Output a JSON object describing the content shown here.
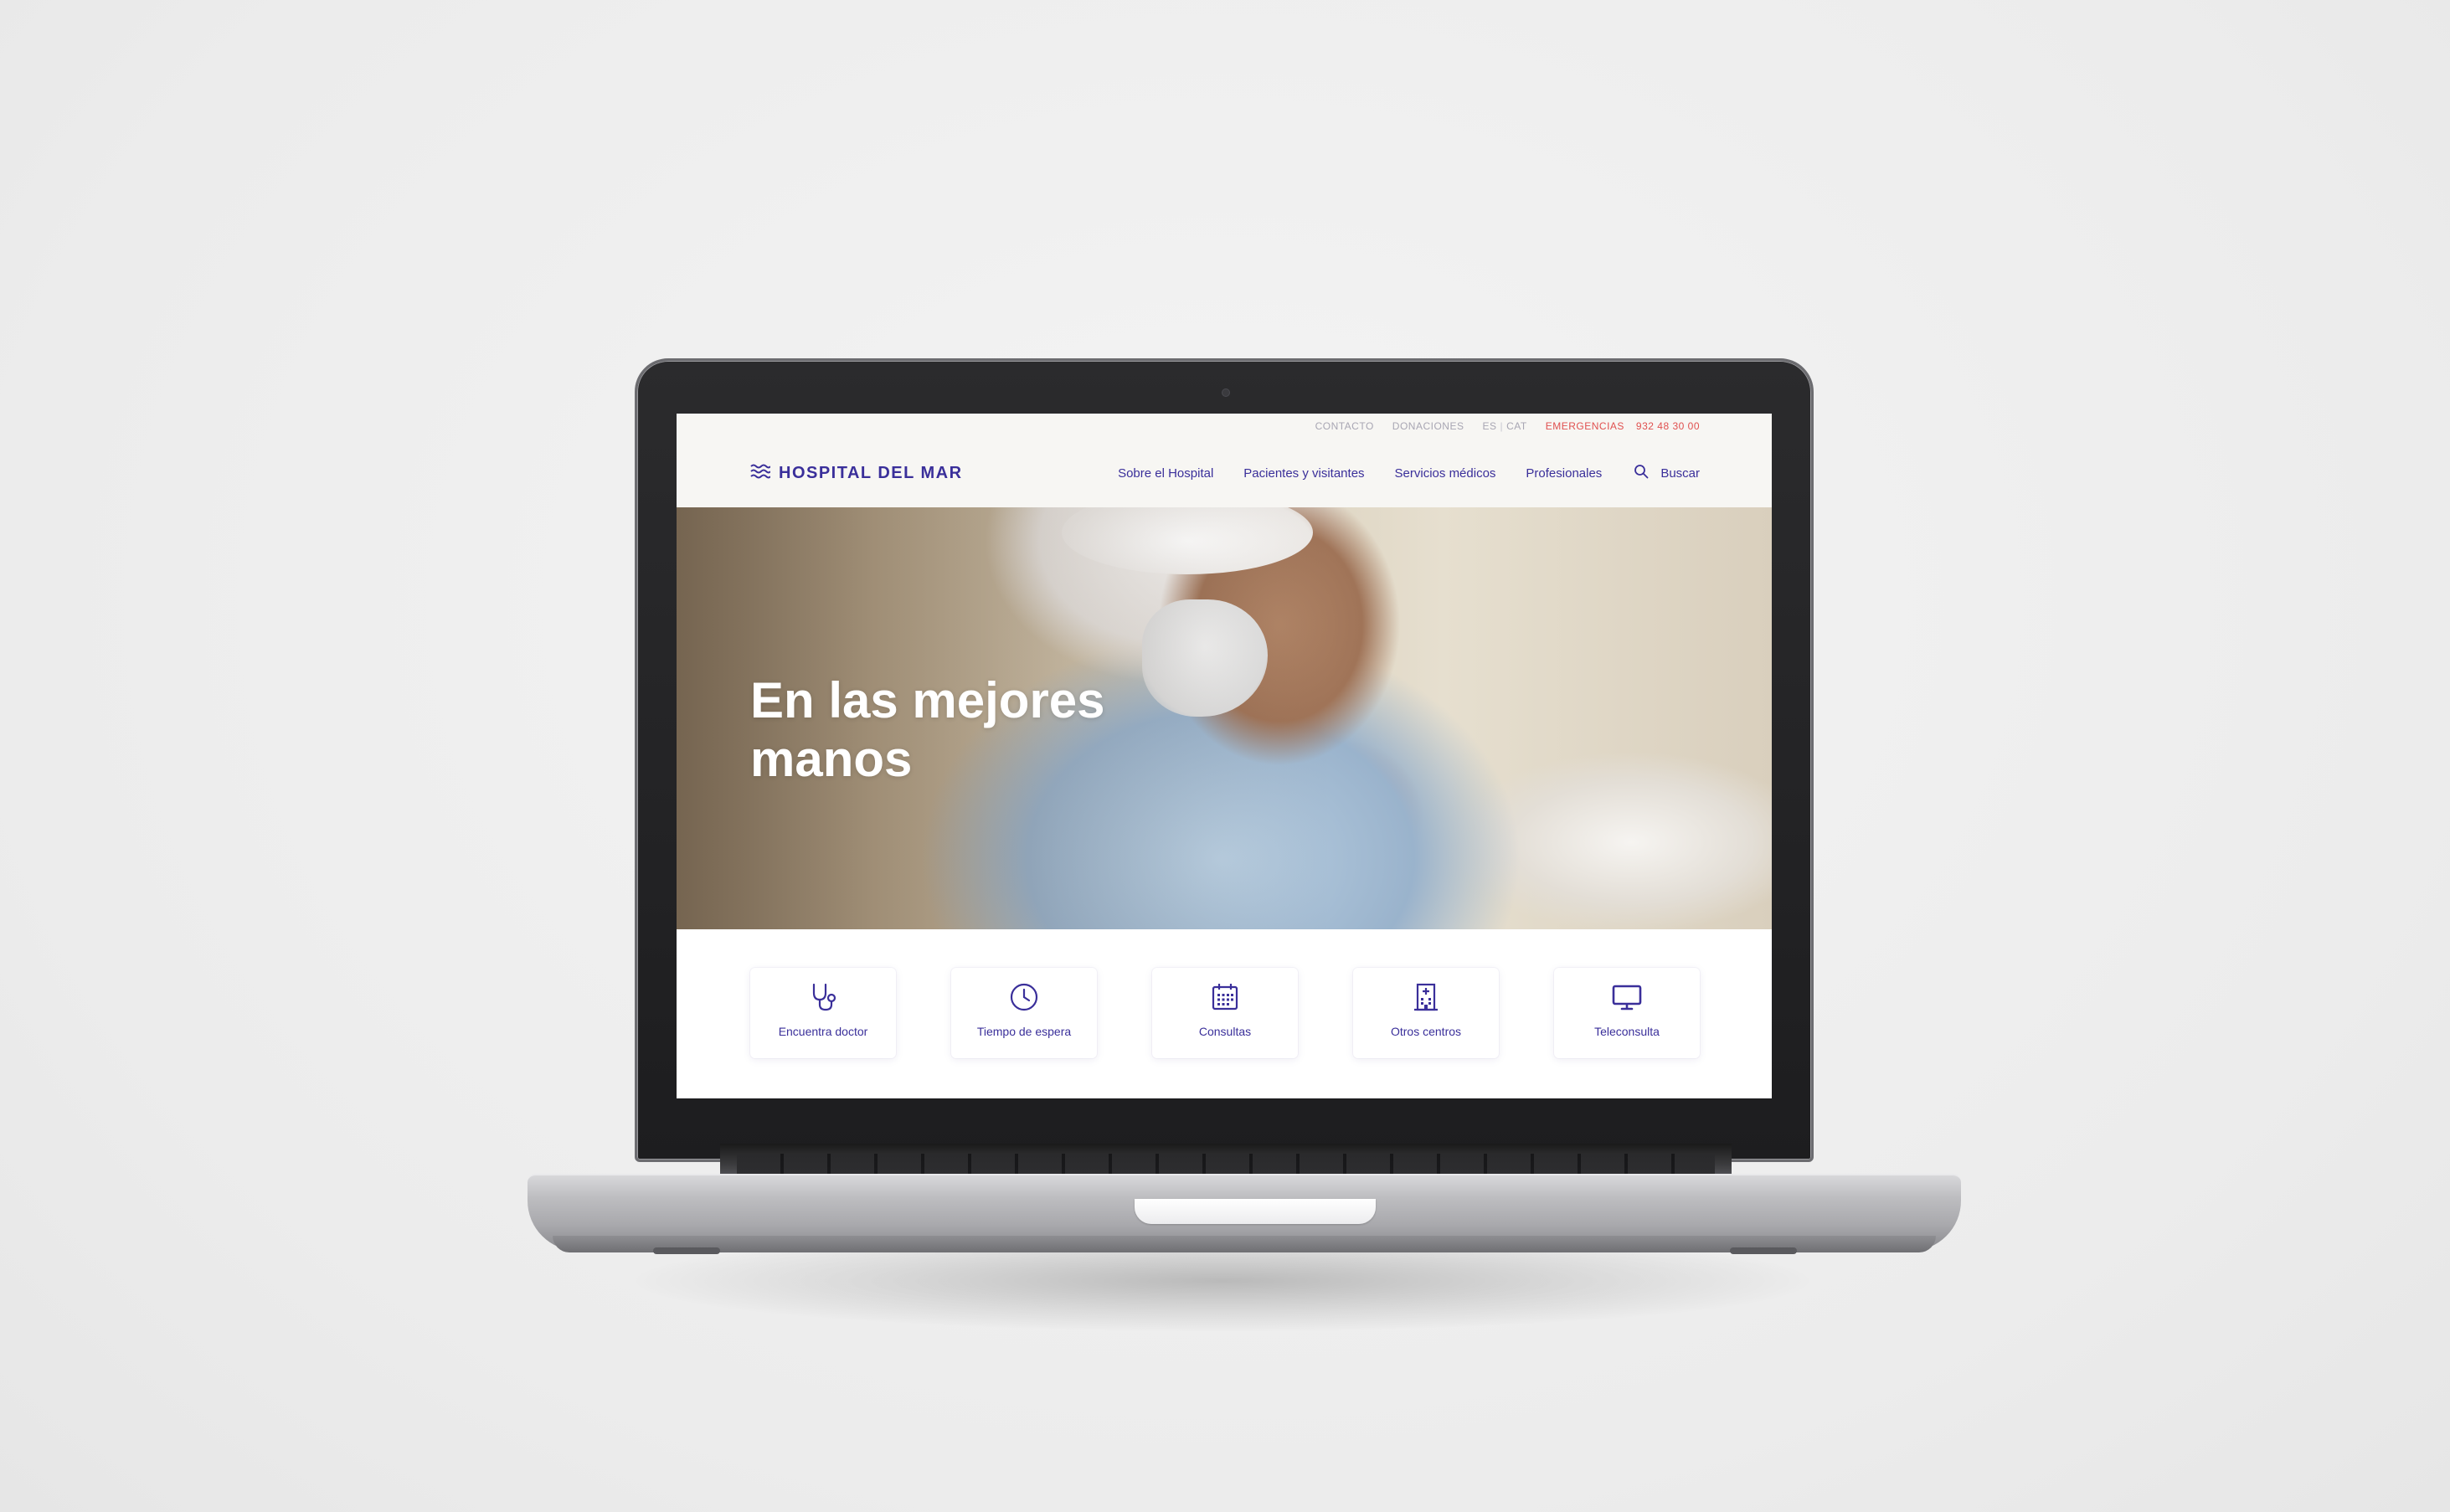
{
  "top_bar": {
    "contact": "CONTACTO",
    "donations": "DONACIONES",
    "lang_es": "ES",
    "lang_sep": "|",
    "lang_cat": "CAT",
    "emergency": "EMERGENCIAS",
    "phone": "932 48 30 00"
  },
  "header": {
    "logo_text": "HOSPITAL DEL MAR",
    "nav": [
      "Sobre el Hospital",
      "Pacientes y visitantes",
      "Servicios médicos",
      "Profesionales"
    ],
    "search_label": "Buscar"
  },
  "hero": {
    "title_line1": "En las mejores",
    "title_line2": "manos"
  },
  "quick_links": [
    {
      "label": "Encuentra doctor",
      "icon": "stethoscope-icon"
    },
    {
      "label": "Tiempo de espera",
      "icon": "clock-icon"
    },
    {
      "label": "Consultas",
      "icon": "calendar-icon"
    },
    {
      "label": "Otros centros",
      "icon": "hospital-building-icon"
    },
    {
      "label": "Teleconsulta",
      "icon": "monitor-icon"
    }
  ],
  "colors": {
    "brand": "#3a2f9a",
    "emergency": "#e0504f",
    "muted": "#a8a6b3"
  }
}
